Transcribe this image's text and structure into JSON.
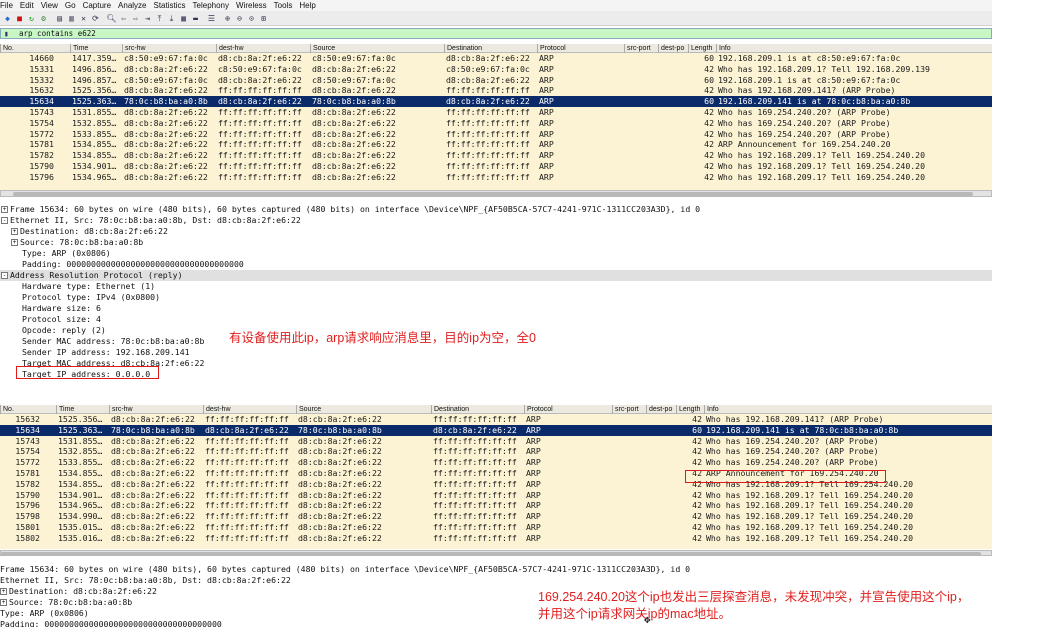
{
  "menu": [
    "File",
    "Edit",
    "View",
    "Go",
    "Capture",
    "Analyze",
    "Statistics",
    "Telephony",
    "Wireless",
    "Tools",
    "Help"
  ],
  "filter": {
    "text": "arp  contains  e622"
  },
  "columns": [
    "No.",
    "Time",
    "src-hw",
    "dest-hw",
    "Source",
    "Destination",
    "Protocol",
    "src-port",
    "dest-po",
    "Length",
    "Info"
  ],
  "packets1": [
    {
      "no": "14660",
      "time": "1417.359…",
      "src_hw": "c8:50:e9:67:fa:0c",
      "dest_hw": "d8:cb:8a:2f:e6:22",
      "source": "c8:50:e9:67:fa:0c",
      "dest": "d8:cb:8a:2f:e6:22",
      "proto": "ARP",
      "len": "60",
      "info": "192.168.209.1 is at c8:50:e9:67:fa:0c"
    },
    {
      "no": "15331",
      "time": "1496.856…",
      "src_hw": "d8:cb:8a:2f:e6:22",
      "dest_hw": "c8:50:e9:67:fa:0c",
      "source": "d8:cb:8a:2f:e6:22",
      "dest": "c8:50:e9:67:fa:0c",
      "proto": "ARP",
      "len": "42",
      "info": "Who has 192.168.209.1? Tell 192.168.209.139"
    },
    {
      "no": "15332",
      "time": "1496.857…",
      "src_hw": "c8:50:e9:67:fa:0c",
      "dest_hw": "d8:cb:8a:2f:e6:22",
      "source": "c8:50:e9:67:fa:0c",
      "dest": "d8:cb:8a:2f:e6:22",
      "proto": "ARP",
      "len": "60",
      "info": "192.168.209.1 is at c8:50:e9:67:fa:0c"
    },
    {
      "no": "15632",
      "time": "1525.356…",
      "src_hw": "d8:cb:8a:2f:e6:22",
      "dest_hw": "ff:ff:ff:ff:ff:ff",
      "source": "d8:cb:8a:2f:e6:22",
      "dest": "ff:ff:ff:ff:ff:ff",
      "proto": "ARP",
      "len": "42",
      "info": "Who has 192.168.209.141? (ARP Probe)"
    },
    {
      "no": "15634",
      "time": "1525.363…",
      "src_hw": "78:0c:b8:ba:a0:8b",
      "dest_hw": "d8:cb:8a:2f:e6:22",
      "source": "78:0c:b8:ba:a0:8b",
      "dest": "d8:cb:8a:2f:e6:22",
      "proto": "ARP",
      "len": "60",
      "info": "192.168.209.141 is at 78:0c:b8:ba:a0:8b",
      "selected": true
    },
    {
      "no": "15743",
      "time": "1531.855…",
      "src_hw": "d8:cb:8a:2f:e6:22",
      "dest_hw": "ff:ff:ff:ff:ff:ff",
      "source": "d8:cb:8a:2f:e6:22",
      "dest": "ff:ff:ff:ff:ff:ff",
      "proto": "ARP",
      "len": "42",
      "info": "Who has 169.254.240.20? (ARP Probe)"
    },
    {
      "no": "15754",
      "time": "1532.855…",
      "src_hw": "d8:cb:8a:2f:e6:22",
      "dest_hw": "ff:ff:ff:ff:ff:ff",
      "source": "d8:cb:8a:2f:e6:22",
      "dest": "ff:ff:ff:ff:ff:ff",
      "proto": "ARP",
      "len": "42",
      "info": "Who has 169.254.240.20? (ARP Probe)"
    },
    {
      "no": "15772",
      "time": "1533.855…",
      "src_hw": "d8:cb:8a:2f:e6:22",
      "dest_hw": "ff:ff:ff:ff:ff:ff",
      "source": "d8:cb:8a:2f:e6:22",
      "dest": "ff:ff:ff:ff:ff:ff",
      "proto": "ARP",
      "len": "42",
      "info": "Who has 169.254.240.20? (ARP Probe)"
    },
    {
      "no": "15781",
      "time": "1534.855…",
      "src_hw": "d8:cb:8a:2f:e6:22",
      "dest_hw": "ff:ff:ff:ff:ff:ff",
      "source": "d8:cb:8a:2f:e6:22",
      "dest": "ff:ff:ff:ff:ff:ff",
      "proto": "ARP",
      "len": "42",
      "info": "ARP Announcement for 169.254.240.20"
    },
    {
      "no": "15782",
      "time": "1534.855…",
      "src_hw": "d8:cb:8a:2f:e6:22",
      "dest_hw": "ff:ff:ff:ff:ff:ff",
      "source": "d8:cb:8a:2f:e6:22",
      "dest": "ff:ff:ff:ff:ff:ff",
      "proto": "ARP",
      "len": "42",
      "info": "Who has 192.168.209.1? Tell 169.254.240.20"
    },
    {
      "no": "15790",
      "time": "1534.901…",
      "src_hw": "d8:cb:8a:2f:e6:22",
      "dest_hw": "ff:ff:ff:ff:ff:ff",
      "source": "d8:cb:8a:2f:e6:22",
      "dest": "ff:ff:ff:ff:ff:ff",
      "proto": "ARP",
      "len": "42",
      "info": "Who has 192.168.209.1? Tell 169.254.240.20"
    },
    {
      "no": "15796",
      "time": "1534.965…",
      "src_hw": "d8:cb:8a:2f:e6:22",
      "dest_hw": "ff:ff:ff:ff:ff:ff",
      "source": "d8:cb:8a:2f:e6:22",
      "dest": "ff:ff:ff:ff:ff:ff",
      "proto": "ARP",
      "len": "42",
      "info": "Who has 192.168.209.1? Tell 169.254.240.20"
    }
  ],
  "details1": [
    {
      "pm": "+",
      "text": "Frame 15634: 60 bytes on wire (480 bits), 60 bytes captured (480 bits) on interface \\Device\\NPF_{AF50B5CA-57C7-4241-971C-1311CC203A3D}, id 0",
      "indent": 0
    },
    {
      "pm": "-",
      "text": "Ethernet II, Src: 78:0c:b8:ba:a0:8b, Dst: d8:cb:8a:2f:e6:22",
      "indent": 0
    },
    {
      "pm": "+",
      "text": "Destination: d8:cb:8a:2f:e6:22",
      "indent": 1
    },
    {
      "pm": "+",
      "text": "Source: 78:0c:b8:ba:a0:8b",
      "indent": 1
    },
    {
      "pm": "",
      "text": "Type: ARP (0x0806)",
      "indent": 2
    },
    {
      "pm": "",
      "text": "Padding: 000000000000000000000000000000000000",
      "indent": 2
    },
    {
      "pm": "-",
      "text": "Address Resolution Protocol (reply)",
      "indent": 0,
      "hl": true
    },
    {
      "pm": "",
      "text": "Hardware type: Ethernet (1)",
      "indent": 2
    },
    {
      "pm": "",
      "text": "Protocol type: IPv4 (0x0800)",
      "indent": 2
    },
    {
      "pm": "",
      "text": "Hardware size: 6",
      "indent": 2
    },
    {
      "pm": "",
      "text": "Protocol size: 4",
      "indent": 2
    },
    {
      "pm": "",
      "text": "Opcode: reply (2)",
      "indent": 2
    },
    {
      "pm": "",
      "text": "Sender MAC address: 78:0c:b8:ba:a0:8b",
      "indent": 2
    },
    {
      "pm": "",
      "text": "Sender IP address: 192.168.209.141",
      "indent": 2
    },
    {
      "pm": "",
      "text": "Target MAC address: d8:cb:8a:2f:e6:22",
      "indent": 2
    },
    {
      "pm": "",
      "text": "Target IP address: 0.0.0.0",
      "indent": 2
    }
  ],
  "annotation1": "有设备使用此ip，arp请求响应消息里，目的ip为空，全0",
  "packets2": [
    {
      "no": "15632",
      "time": "1525.356…",
      "src_hw": "d8:cb:8a:2f:e6:22",
      "dest_hw": "ff:ff:ff:ff:ff:ff",
      "source": "d8:cb:8a:2f:e6:22",
      "dest": "ff:ff:ff:ff:ff:ff",
      "proto": "ARP",
      "len": "42",
      "info": "Who has 192.168.209.141? (ARP Probe)"
    },
    {
      "no": "15634",
      "time": "1525.363…",
      "src_hw": "78:0c:b8:ba:a0:8b",
      "dest_hw": "d8:cb:8a:2f:e6:22",
      "source": "78:0c:b8:ba:a0:8b",
      "dest": "d8:cb:8a:2f:e6:22",
      "proto": "ARP",
      "len": "60",
      "info": "192.168.209.141 is at 78:0c:b8:ba:a0:8b",
      "selected": true
    },
    {
      "no": "15743",
      "time": "1531.855…",
      "src_hw": "d8:cb:8a:2f:e6:22",
      "dest_hw": "ff:ff:ff:ff:ff:ff",
      "source": "d8:cb:8a:2f:e6:22",
      "dest": "ff:ff:ff:ff:ff:ff",
      "proto": "ARP",
      "len": "42",
      "info": "Who has 169.254.240.20? (ARP Probe)"
    },
    {
      "no": "15754",
      "time": "1532.855…",
      "src_hw": "d8:cb:8a:2f:e6:22",
      "dest_hw": "ff:ff:ff:ff:ff:ff",
      "source": "d8:cb:8a:2f:e6:22",
      "dest": "ff:ff:ff:ff:ff:ff",
      "proto": "ARP",
      "len": "42",
      "info": "Who has 169.254.240.20? (ARP Probe)"
    },
    {
      "no": "15772",
      "time": "1533.855…",
      "src_hw": "d8:cb:8a:2f:e6:22",
      "dest_hw": "ff:ff:ff:ff:ff:ff",
      "source": "d8:cb:8a:2f:e6:22",
      "dest": "ff:ff:ff:ff:ff:ff",
      "proto": "ARP",
      "len": "42",
      "info": "Who has 169.254.240.20? (ARP Probe)"
    },
    {
      "no": "15781",
      "time": "1534.855…",
      "src_hw": "d8:cb:8a:2f:e6:22",
      "dest_hw": "ff:ff:ff:ff:ff:ff",
      "source": "d8:cb:8a:2f:e6:22",
      "dest": "ff:ff:ff:ff:ff:ff",
      "proto": "ARP",
      "len": "42",
      "info": "ARP Announcement for 169.254.240.20"
    },
    {
      "no": "15782",
      "time": "1534.855…",
      "src_hw": "d8:cb:8a:2f:e6:22",
      "dest_hw": "ff:ff:ff:ff:ff:ff",
      "source": "d8:cb:8a:2f:e6:22",
      "dest": "ff:ff:ff:ff:ff:ff",
      "proto": "ARP",
      "len": "42",
      "info": "Who has 192.168.209.1? Tell 169.254.240.20"
    },
    {
      "no": "15790",
      "time": "1534.901…",
      "src_hw": "d8:cb:8a:2f:e6:22",
      "dest_hw": "ff:ff:ff:ff:ff:ff",
      "source": "d8:cb:8a:2f:e6:22",
      "dest": "ff:ff:ff:ff:ff:ff",
      "proto": "ARP",
      "len": "42",
      "info": "Who has 192.168.209.1? Tell 169.254.240.20"
    },
    {
      "no": "15796",
      "time": "1534.965…",
      "src_hw": "d8:cb:8a:2f:e6:22",
      "dest_hw": "ff:ff:ff:ff:ff:ff",
      "source": "d8:cb:8a:2f:e6:22",
      "dest": "ff:ff:ff:ff:ff:ff",
      "proto": "ARP",
      "len": "42",
      "info": "Who has 192.168.209.1? Tell 169.254.240.20"
    },
    {
      "no": "15798",
      "time": "1534.990…",
      "src_hw": "d8:cb:8a:2f:e6:22",
      "dest_hw": "ff:ff:ff:ff:ff:ff",
      "source": "d8:cb:8a:2f:e6:22",
      "dest": "ff:ff:ff:ff:ff:ff",
      "proto": "ARP",
      "len": "42",
      "info": "Who has 192.168.209.1? Tell 169.254.240.20"
    },
    {
      "no": "15801",
      "time": "1535.015…",
      "src_hw": "d8:cb:8a:2f:e6:22",
      "dest_hw": "ff:ff:ff:ff:ff:ff",
      "source": "d8:cb:8a:2f:e6:22",
      "dest": "ff:ff:ff:ff:ff:ff",
      "proto": "ARP",
      "len": "42",
      "info": "Who has 192.168.209.1? Tell 169.254.240.20"
    },
    {
      "no": "15802",
      "time": "1535.016…",
      "src_hw": "d8:cb:8a:2f:e6:22",
      "dest_hw": "ff:ff:ff:ff:ff:ff",
      "source": "d8:cb:8a:2f:e6:22",
      "dest": "ff:ff:ff:ff:ff:ff",
      "proto": "ARP",
      "len": "42",
      "info": "Who has 192.168.209.1? Tell 169.254.240.20"
    }
  ],
  "details2": [
    {
      "pm": "",
      "text": "Frame 15634: 60 bytes on wire (480 bits), 60 bytes captured (480 bits) on interface \\Device\\NPF_{AF50B5CA-57C7-4241-971C-1311CC203A3D}, id 0",
      "indent": 0
    },
    {
      "pm": "",
      "text": "Ethernet II, Src: 78:0c:b8:ba:a0:8b, Dst: d8:cb:8a:2f:e6:22",
      "indent": 0
    },
    {
      "pm": "+",
      "text": "Destination: d8:cb:8a:2f:e6:22",
      "indent": 0
    },
    {
      "pm": "+",
      "text": "Source: 78:0c:b8:ba:a0:8b",
      "indent": 0
    },
    {
      "pm": "",
      "text": "Type: ARP (0x0806)",
      "indent": 1
    },
    {
      "pm": "",
      "text": "Padding: 000000000000000000000000000000000000",
      "indent": 1
    }
  ],
  "annotation2_line1": "169.254.240.20这个ip也发出三层探查消息，未发现冲突，并宣告使用这个ip，",
  "annotation2_line2": "并用这个ip请求网关ip的mac地址。",
  "colors": {
    "row_bg": "#fbf3d3",
    "selected": "#0a2a6a",
    "annotation": "#e02020",
    "filter_bg": "#c8f7c5"
  }
}
